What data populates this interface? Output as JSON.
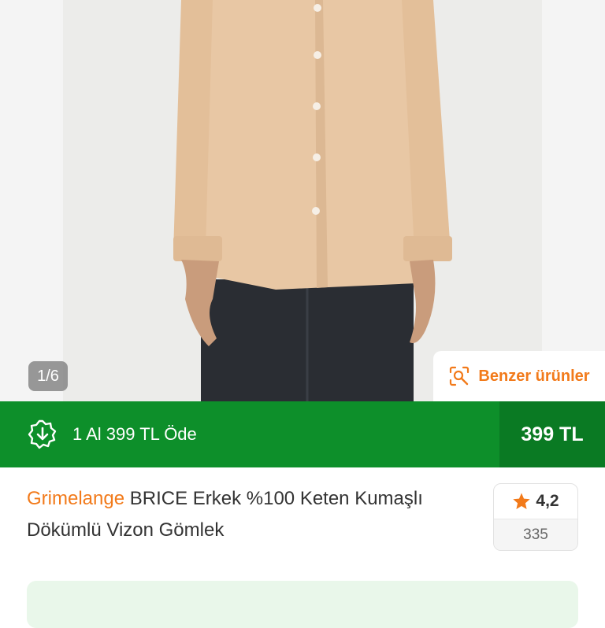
{
  "gallery": {
    "counter": "1/6",
    "similar_label": "Benzer ürünler"
  },
  "promo": {
    "text": "1 Al 399 TL Öde",
    "price": "399 TL"
  },
  "product": {
    "brand": "Grimelange",
    "name": " BRICE Erkek %100 Keten Kumaşlı Dökümlü Vizon Gömlek"
  },
  "rating": {
    "score": "4,2",
    "count": "335"
  },
  "colors": {
    "accent": "#f27a1a",
    "promo_green": "#0d8f2a",
    "promo_green_dark": "#0a7a23"
  },
  "icons": {
    "similar": "image-search-icon",
    "promo": "download-badge-icon",
    "rating": "star-icon"
  }
}
